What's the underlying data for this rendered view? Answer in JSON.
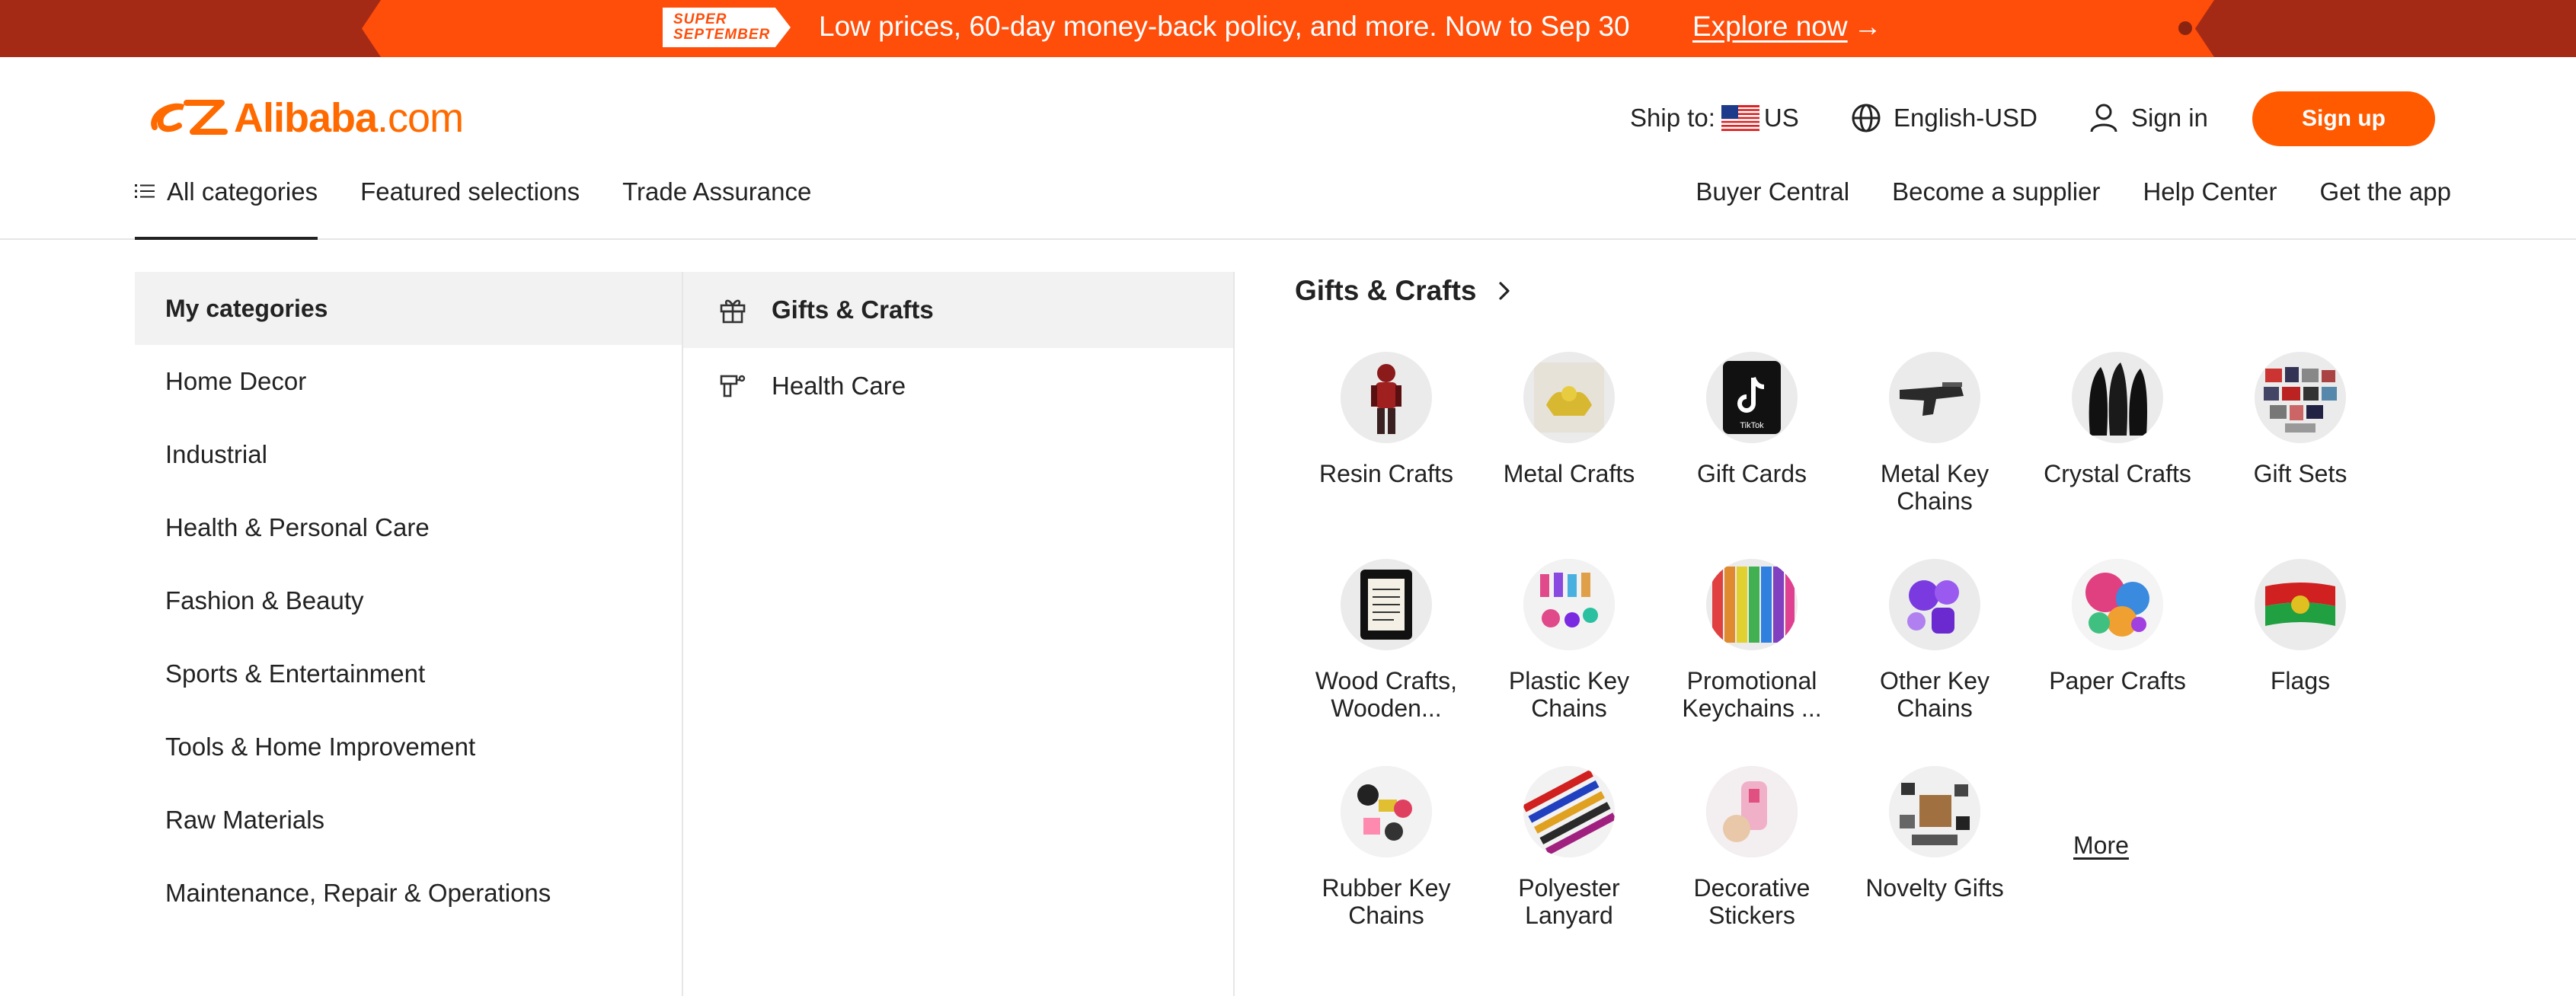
{
  "banner": {
    "badge_line1": "SUPER",
    "badge_line2": "SEPTEMBER",
    "text": "Low prices, 60-day money-back policy, and more. Now to Sep 30",
    "link": "Explore now",
    "link_arrow": "→",
    "colors": {
      "background": "#ff4d0a",
      "edges": "#a52a16"
    }
  },
  "header": {
    "logo": {
      "name": "Alibaba",
      "suffix": ".com",
      "color": "#ff6a00"
    },
    "ship_label": "Ship to:",
    "ship_country": "US",
    "language": "English-USD",
    "signin": "Sign in",
    "signup": "Sign up",
    "nav_left": [
      "All categories",
      "Featured selections",
      "Trade Assurance"
    ],
    "nav_right": [
      "Buyer Central",
      "Become a supplier",
      "Help Center",
      "Get the app"
    ]
  },
  "sidebar": {
    "heading": "My categories",
    "items": [
      "Home Decor",
      "Industrial",
      "Health & Personal Care",
      "Fashion & Beauty",
      "Sports & Entertainment",
      "Tools & Home Improvement",
      "Raw Materials",
      "Maintenance, Repair & Operations"
    ]
  },
  "subcategories": [
    {
      "label": "Gifts & Crafts",
      "icon": "gift-icon",
      "active": true
    },
    {
      "label": "Health Care",
      "icon": "spray-icon",
      "active": false
    }
  ],
  "panel": {
    "title": "Gifts & Crafts",
    "tiles": [
      {
        "label": "Resin Crafts",
        "icon": "resin-figure-icon"
      },
      {
        "label": "Metal Crafts",
        "icon": "metal-craft-icon"
      },
      {
        "label": "Gift Cards",
        "icon": "tiktok-card-icon",
        "card_text": "TikTok"
      },
      {
        "label": "Metal Key Chains",
        "icon": "pistol-keychain-icon"
      },
      {
        "label": "Crystal Crafts",
        "icon": "crystal-craft-icon"
      },
      {
        "label": "Gift Sets",
        "icon": "gift-set-icon"
      },
      {
        "label": "Wood Crafts, Wooden...",
        "icon": "wood-frame-icon"
      },
      {
        "label": "Plastic Key Chains",
        "icon": "plastic-keychain-icon"
      },
      {
        "label": "Promotional Keychains ...",
        "icon": "promo-keychain-icon"
      },
      {
        "label": "Other Key Chains",
        "icon": "other-keychain-icon"
      },
      {
        "label": "Paper Crafts",
        "icon": "paper-craft-icon"
      },
      {
        "label": "Flags",
        "icon": "flag-icon"
      },
      {
        "label": "Rubber Key Chains",
        "icon": "rubber-keychain-icon"
      },
      {
        "label": "Polyester Lanyard",
        "icon": "lanyard-icon"
      },
      {
        "label": "Decorative Stickers",
        "icon": "sticker-icon"
      },
      {
        "label": "Novelty Gifts",
        "icon": "novelty-gift-icon"
      }
    ],
    "more": "More"
  }
}
